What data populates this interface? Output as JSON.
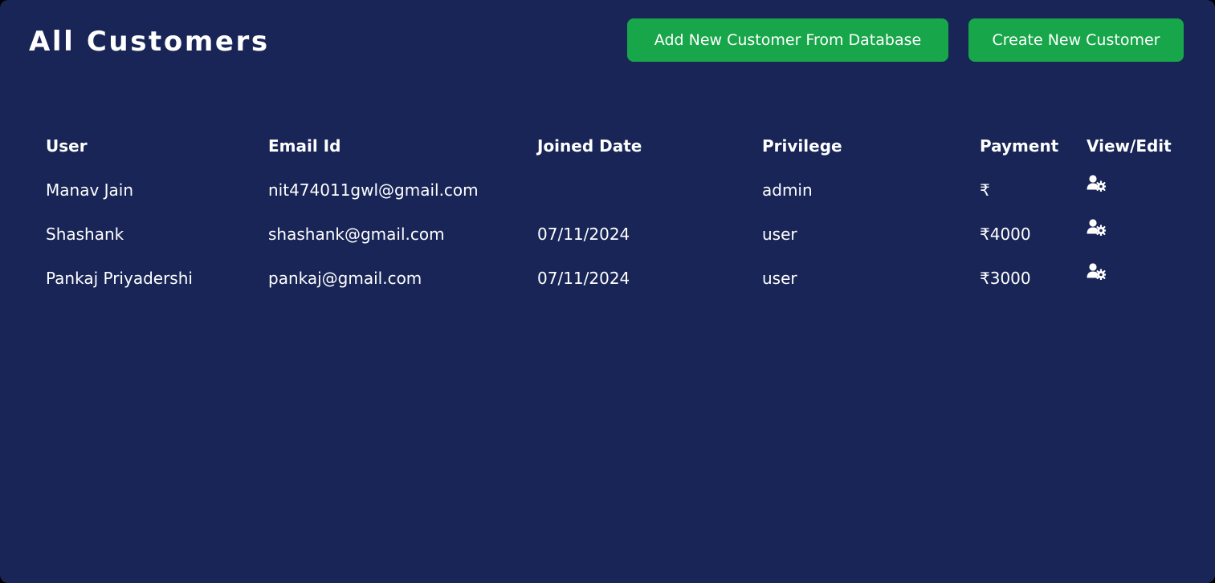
{
  "page": {
    "title": "All Customers",
    "background_color": "#182556",
    "accent_color": "#18a64a"
  },
  "actions": {
    "add_from_database_label": "Add New Customer From Database",
    "create_customer_label": "Create New Customer"
  },
  "table": {
    "columns": [
      "User",
      "Email Id",
      "Joined Date",
      "Privilege",
      "Payment",
      "View/Edit"
    ],
    "rows": [
      {
        "user": "Manav Jain",
        "email": "nit474011gwl@gmail.com",
        "joined": "",
        "privilege": "admin",
        "payment": "₹",
        "edit_icon": "user-gear-icon"
      },
      {
        "user": "Shashank",
        "email": "shashank@gmail.com",
        "joined": "07/11/2024",
        "privilege": "user",
        "payment": "₹4000",
        "edit_icon": "user-gear-icon"
      },
      {
        "user": "Pankaj Priyadershi",
        "email": "pankaj@gmail.com",
        "joined": "07/11/2024",
        "privilege": "user",
        "payment": "₹3000",
        "edit_icon": "user-gear-icon"
      }
    ]
  }
}
